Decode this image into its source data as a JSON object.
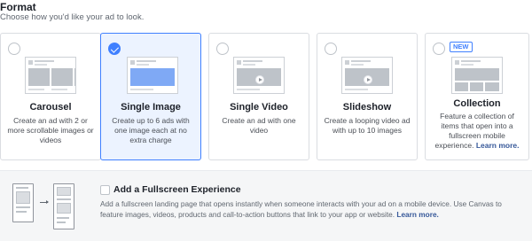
{
  "header": {
    "title": "Format",
    "subtitle": "Choose how you'd like your ad to look."
  },
  "formats": [
    {
      "name": "Carousel",
      "description": "Create an ad with 2 or more scrollable images or videos",
      "selected": false,
      "icon": "carousel-preview-icon"
    },
    {
      "name": "Single Image",
      "description": "Create up to 6 ads with one image each at no extra charge",
      "selected": true,
      "icon": "single-image-preview-icon"
    },
    {
      "name": "Single Video",
      "description": "Create an ad with one video",
      "selected": false,
      "icon": "single-video-preview-icon"
    },
    {
      "name": "Slideshow",
      "description": "Create a looping video ad with up to 10 images",
      "selected": false,
      "icon": "slideshow-preview-icon"
    },
    {
      "name": "Collection",
      "description": "Feature a collection of items that open into a fullscreen mobile experience.",
      "link": "Learn more.",
      "badge": "NEW",
      "selected": false,
      "icon": "collection-preview-icon"
    }
  ],
  "fullscreen": {
    "title": "Add a Fullscreen Experience",
    "description": "Add a fullscreen landing page that opens instantly when someone interacts with your ad on a mobile device. Use Canvas to feature images, videos, products and call-to-action buttons that link to your app or website.",
    "link": "Learn more.",
    "checked": false,
    "icon": "fullscreen-experience-illustration"
  },
  "colors": {
    "accent": "#4080ff",
    "selected_bg": "#ecf3ff",
    "link": "#365899",
    "border": "#dadde1"
  }
}
